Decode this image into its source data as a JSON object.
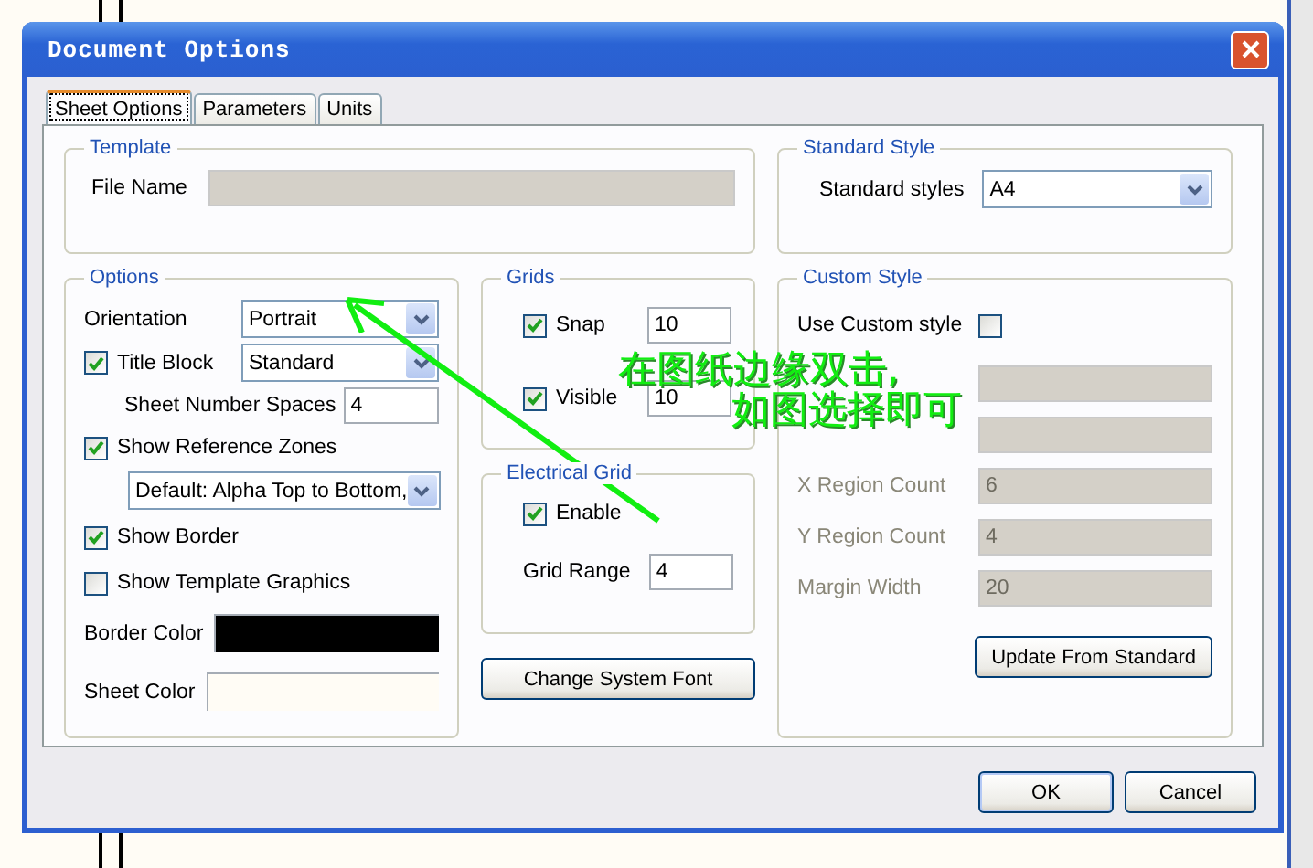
{
  "window": {
    "title": "Document Options"
  },
  "tabs": [
    {
      "label": "Sheet Options",
      "selected": true
    },
    {
      "label": "Parameters",
      "selected": false
    },
    {
      "label": "Units",
      "selected": false
    }
  ],
  "template": {
    "title": "Template",
    "file_name": {
      "label": "File Name"
    }
  },
  "standard_style": {
    "title": "Standard Style",
    "label": "Standard styles",
    "value": "A4"
  },
  "options": {
    "title": "Options",
    "orientation": {
      "label": "Orientation",
      "value": "Portrait"
    },
    "title_block": {
      "label": "Title Block",
      "checked": true,
      "value": "Standard"
    },
    "sheet_number_spaces": {
      "label": "Sheet Number Spaces",
      "value": "4"
    },
    "show_reference_zones": {
      "label": "Show Reference Zones",
      "checked": true
    },
    "zones_style": {
      "value": "Default: Alpha Top to Bottom,"
    },
    "show_border": {
      "label": "Show Border",
      "checked": true
    },
    "show_template_graphics": {
      "label": "Show Template Graphics",
      "checked": false
    },
    "border_color": {
      "label": "Border Color",
      "color": "#000000"
    },
    "sheet_color": {
      "label": "Sheet Color",
      "color": "#fffcf5"
    }
  },
  "grids": {
    "title": "Grids",
    "items": [
      {
        "label": "Snap",
        "checked": true,
        "value": "10"
      },
      {
        "label": "Visible",
        "checked": true,
        "value": "10"
      }
    ]
  },
  "electrical_grid": {
    "title": "Electrical Grid",
    "enable": {
      "label": "Enable",
      "checked": true
    },
    "range": {
      "label": "Grid Range",
      "value": "4"
    }
  },
  "change_font_button": "Change System Font",
  "custom_style": {
    "title": "Custom Style",
    "use_custom": {
      "label": "Use Custom style",
      "checked": false
    },
    "fields": [
      {
        "disabled": true
      },
      {
        "disabled": true
      },
      {
        "label": "X Region Count",
        "value": "6",
        "disabled": true
      },
      {
        "label": "Y Region Count",
        "value": "4",
        "disabled": true
      },
      {
        "label": "Margin Width",
        "value": "20",
        "disabled": true
      }
    ],
    "update_button": "Update From Standard"
  },
  "buttons": [
    {
      "label": "OK",
      "default": true
    },
    {
      "label": "Cancel",
      "default": false
    }
  ],
  "annotation": {
    "lines": [
      "在图纸边缘双击,",
      "如图选择即可"
    ]
  }
}
